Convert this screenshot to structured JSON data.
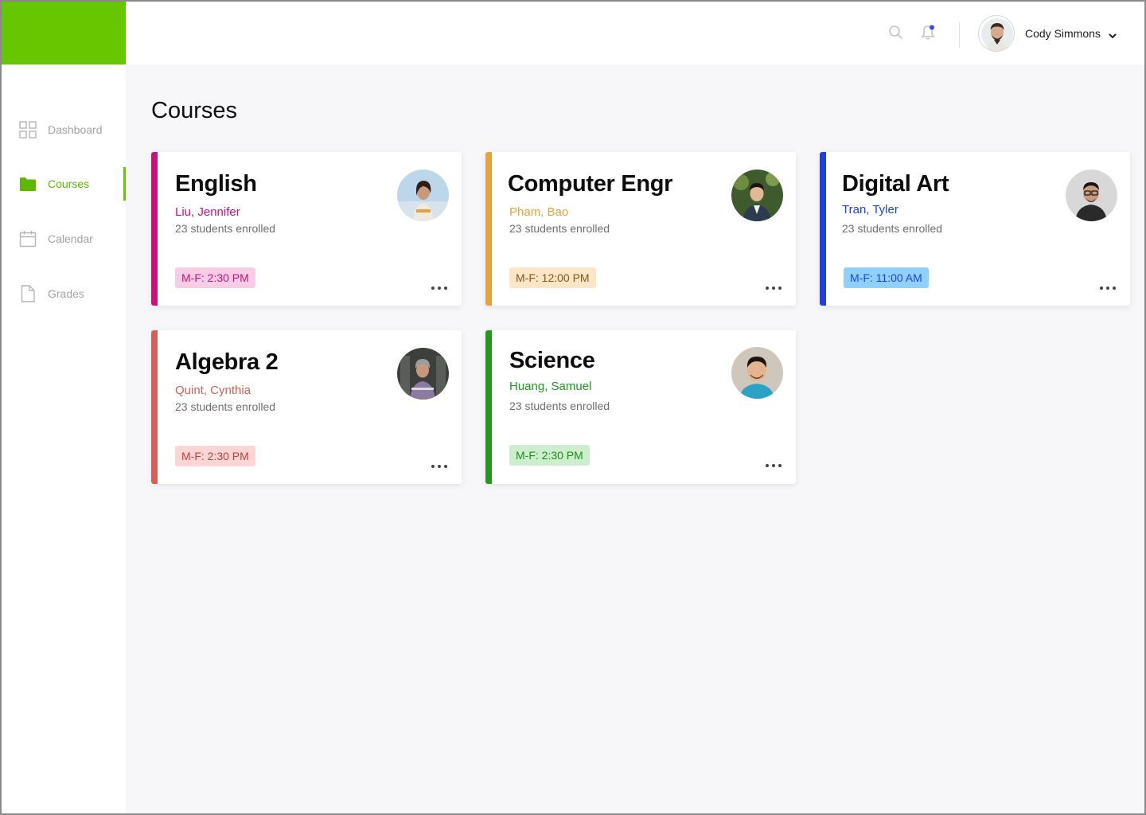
{
  "app": {
    "brand_color": "#66c600"
  },
  "sidebar": {
    "items": [
      {
        "label": "Dashboard",
        "icon": "grid-icon",
        "active": false
      },
      {
        "label": "Courses",
        "icon": "folder-icon",
        "active": true
      },
      {
        "label": "Calendar",
        "icon": "calendar-icon",
        "active": false
      },
      {
        "label": "Grades",
        "icon": "document-icon",
        "active": false
      }
    ]
  },
  "header": {
    "search_icon": "search-icon",
    "notification_icon": "bell-icon",
    "has_unread_notification": true,
    "user": {
      "name": "Cody Simmons",
      "avatar": "avatar-icon",
      "menu_icon": "chevron-down-icon"
    }
  },
  "main": {
    "title": "Courses",
    "courses": [
      {
        "title": "English",
        "teacher": "Liu, Jennifer",
        "enrolled": "23 students enrolled",
        "schedule": "M-F: 2:30 PM",
        "accent": "#c8107f",
        "badge_bg": "#f7cde5",
        "badge_fg": "#c8107f"
      },
      {
        "title": "Computer Engr",
        "teacher": "Pham, Bao",
        "enrolled": "23 students enrolled",
        "schedule": "M-F: 12:00 PM",
        "accent": "#e9a13b",
        "badge_bg": "#fde5c7",
        "badge_fg": "#8a5516"
      },
      {
        "title": "Digital Art",
        "teacher": "Tran, Tyler",
        "enrolled": "23 students enrolled",
        "schedule": "M-F: 11:00 AM",
        "accent": "#1f3fe0",
        "badge_bg": "#8fd0ff",
        "badge_fg": "#1f3fe0"
      },
      {
        "title": "Algebra 2",
        "teacher": "Quint, Cynthia",
        "enrolled": "23 students enrolled",
        "schedule": "M-F: 2:30 PM",
        "accent": "#d65f59",
        "badge_bg": "#fbd6d4",
        "badge_fg": "#c2403a"
      },
      {
        "title": "Science",
        "teacher": "Huang, Samuel",
        "enrolled": "23 students enrolled",
        "schedule": "M-F: 2:30 PM",
        "accent": "#1f9a1f",
        "badge_bg": "#cdeecd",
        "badge_fg": "#1f8a1f"
      }
    ]
  }
}
